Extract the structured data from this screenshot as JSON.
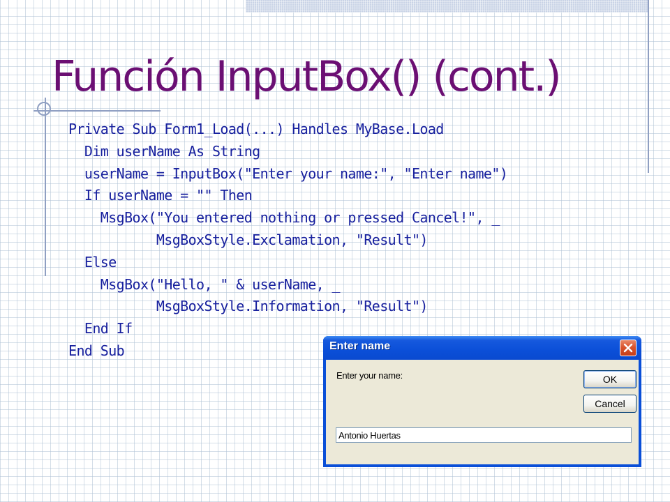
{
  "slide": {
    "title": "Función InputBox() (cont.)",
    "code_lines": [
      "Private Sub Form1_Load(...) Handles MyBase.Load",
      "  Dim userName As String",
      "  userName = InputBox(\"Enter your name:\", \"Enter name\")",
      "  If userName = \"\" Then",
      "    MsgBox(\"You entered nothing or pressed Cancel!\", _",
      "           MsgBoxStyle.Exclamation, \"Result\")",
      "  Else",
      "    MsgBox(\"Hello, \" & userName, _",
      "           MsgBoxStyle.Information, \"Result\")",
      "  End If",
      "End Sub"
    ]
  },
  "dialog": {
    "title": "Enter name",
    "prompt": "Enter your name:",
    "ok_label": "OK",
    "cancel_label": "Cancel",
    "input_value": "Antonio Huertas",
    "close_icon": "close-icon"
  },
  "colors": {
    "title": "#6b0f73",
    "code": "#17209e",
    "titlebar": "#0a4fd8",
    "dialog_face": "#ece9d8"
  }
}
